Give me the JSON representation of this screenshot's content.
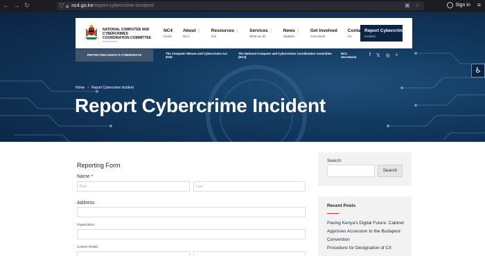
{
  "browser": {
    "url_domain": "nc4.go.ke",
    "url_path": "/report-cybercrime-incident/",
    "signin_label": "Sign in"
  },
  "header": {
    "org_name": "National Computer and Cybercrimes Coordination Committee",
    "nav": [
      {
        "label": "NC4",
        "sub": "Home",
        "has_caret": false
      },
      {
        "label": "About",
        "sub": "NC4",
        "has_caret": true
      },
      {
        "label": "Resources",
        "sub": "Info",
        "has_caret": true
      },
      {
        "label": "Services",
        "sub": "What we do",
        "has_caret": true
      },
      {
        "label": "News",
        "sub": "Updates",
        "has_caret": true
      },
      {
        "label": "Get Involved",
        "sub": "Comments",
        "has_caret": false
      },
      {
        "label": "Contact",
        "sub": "Us",
        "has_caret": false
      }
    ],
    "report_button": {
      "label": "Report Cybercrime",
      "sub": "Incident"
    }
  },
  "strip": {
    "label": "Protecting Kenya's Cyberspace",
    "tickers": [
      "The Computer Misuse and Cybercrimes Act 2018",
      "The National Computer and Cybercrimes Coordination Committee (NC4)",
      "NC4 Secretariat"
    ],
    "socials": [
      "facebook-icon",
      "x-icon",
      "instagram-icon",
      "search-icon"
    ]
  },
  "breadcrumb": {
    "home": "Home",
    "separator": "›",
    "current": "Report Cybercrime Incident"
  },
  "page_title": "Report Cybercrime Incident",
  "form": {
    "heading": "Reporting Form",
    "name_label": "Name *",
    "first_placeholder": "First",
    "last_placeholder": "Last",
    "address_label": "Address",
    "organization_label": "Organization",
    "contact_label": "Contact Details"
  },
  "sidebar": {
    "search_label": "Search",
    "search_button": "Search",
    "recent_title": "Recent Posts",
    "recent_posts": [
      "Paving Kenya's Digital Future: Cabinet Approves Accession to the Budapest Convention",
      "Procedure for Designation of CII"
    ]
  },
  "colors": {
    "brand_navy": "#0b2443",
    "accent_red": "#c0392b"
  }
}
